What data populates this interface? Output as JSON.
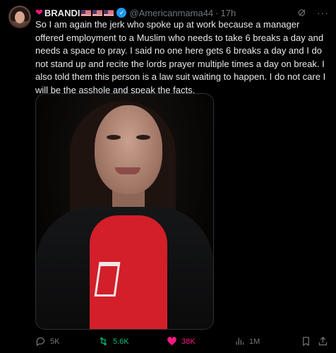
{
  "post": {
    "display_name": "BRANDI",
    "handle": "@Americanmama44",
    "separator": "·",
    "time": "17h",
    "text": "So I am again the jerk who spoke up at work because a manager offered employment to a Muslim who needs to take 6 breaks a day and needs a space to pray. I said no one here gets 6 breaks a day and I do not stand up and recite the lords prayer multiple times a day on break. I also told them this person is a law suit waiting to happen. I do not care I will be the asshole and speak the facts.",
    "verified_mark": "✓",
    "heart_emoji": "❤",
    "more_glyph": "···"
  },
  "actions": {
    "replies": "5K",
    "reposts": "5.6K",
    "likes": "38K",
    "views": "1M"
  },
  "colors": {
    "background": "#000000",
    "text": "#e7e9ea",
    "muted": "#71767b",
    "verified": "#1d9bf0",
    "repost_active": "#00ba7c",
    "like_active": "#f91880"
  },
  "icons": [
    "heart-emoji",
    "us-flag-icon",
    "verified-badge-icon",
    "grok-icon",
    "more-icon",
    "reply-icon",
    "repost-icon",
    "like-icon",
    "views-icon",
    "bookmark-icon",
    "share-icon"
  ]
}
